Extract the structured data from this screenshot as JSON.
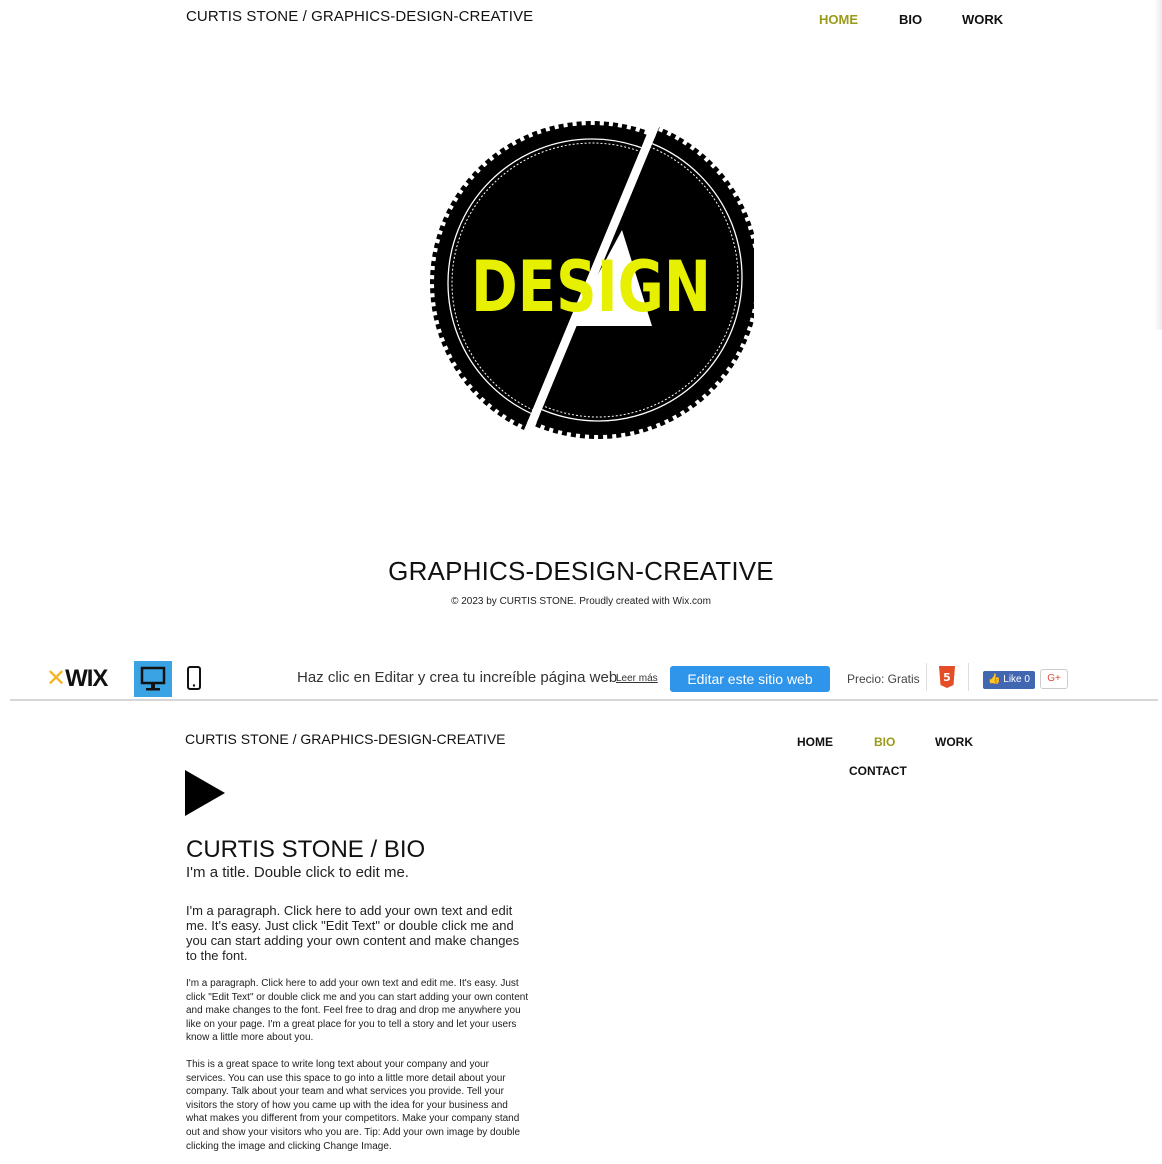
{
  "top": {
    "site_title": "CURTIS STONE / GRAPHICS-DESIGN-CREATIVE",
    "nav": [
      {
        "label": "HOME",
        "active": true
      },
      {
        "label": "BIO",
        "active": false
      },
      {
        "label": "WORK",
        "active": false
      }
    ],
    "logo_text": "DESIGN",
    "tagline": "GRAPHICS-DESIGN-CREATIVE",
    "copyright": "© 2023 by CURTIS STONE. Proudly created with Wix.com"
  },
  "wix_bar": {
    "logo": "WIX",
    "message": "Haz clic en Editar y crea tu increíble página web",
    "learn_more": "Leer más",
    "edit_button": "Editar este sitio web",
    "price": "Precio: Gratis",
    "like_label": "Like 0",
    "gplus_label": "G+",
    "icons": [
      "desktop-icon",
      "mobile-icon",
      "html5-icon",
      "facebook-like-icon",
      "google-plus-icon"
    ]
  },
  "bio_page": {
    "site_title": "CURTIS STONE / GRAPHICS-DESIGN-CREATIVE",
    "nav": [
      {
        "label": "HOME",
        "active": false
      },
      {
        "label": "BIO",
        "active": true
      },
      {
        "label": "WORK",
        "active": false
      },
      {
        "label": "CONTACT",
        "active": false
      }
    ],
    "title": "CURTIS STONE / BIO",
    "subtitle": "I'm a title. Double click to edit me.",
    "paragraph1": "I'm a paragraph. Click here to add your own text and edit me. It's easy. Just click \"Edit Text\" or double click me and you can start adding your own content and make changes to the font.",
    "paragraph2": "I'm a paragraph. Click here to add your own text and edit me. It's easy. Just click \"Edit Text\" or double click me and you can start adding your own content and make changes to the font. Feel free to drag and drop me anywhere you like on your page. I'm a great place for you to tell a story and let your users know a little more about you.",
    "paragraph3": "This is a great space to write long text about your company and your services. You can use this space to go into a little more detail about your company. Talk about your team and what services you provide. Tell your visitors the story of how you came up with the idea for your business and what makes you different from your competitors. Make your company stand out and show your visitors who you are. Tip: Add your own image by double clicking the image and clicking Change Image."
  },
  "colors": {
    "accent_active": "#9a9a1a",
    "logo_yellow": "#e6f000",
    "wix_blue": "#2f95ea",
    "desktop_blue": "#3aa3e3",
    "facebook_blue": "#4267b2"
  }
}
